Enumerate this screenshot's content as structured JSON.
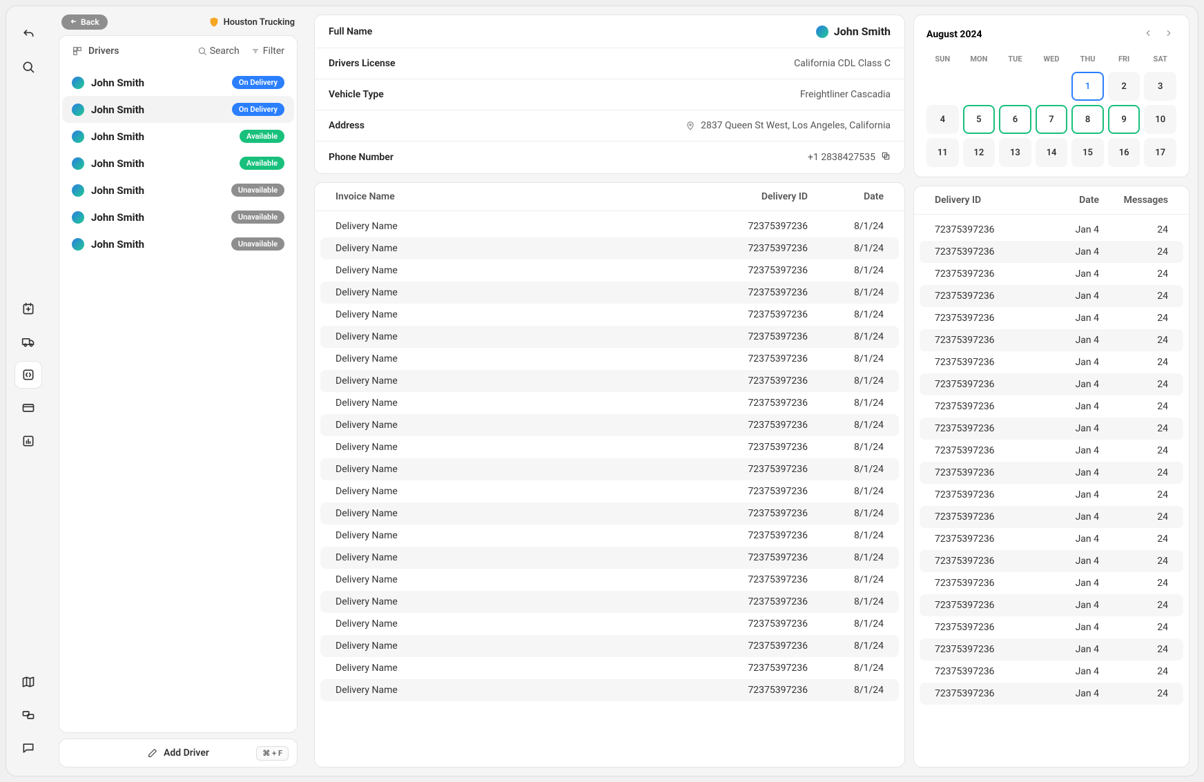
{
  "nav": {
    "back": "Back",
    "org": "Houston Trucking"
  },
  "drivers": {
    "title": "Drivers",
    "search": "Search",
    "filter": "Filter",
    "add": "Add Driver",
    "shortcut": "⌘ + F",
    "items": [
      {
        "name": "John Smith",
        "status": "On Delivery",
        "cls": "on-delivery",
        "selected": false
      },
      {
        "name": "John Smith",
        "status": "On Delivery",
        "cls": "on-delivery",
        "selected": true
      },
      {
        "name": "John Smith",
        "status": "Available",
        "cls": "available",
        "selected": false
      },
      {
        "name": "John Smith",
        "status": "Available",
        "cls": "available",
        "selected": false
      },
      {
        "name": "John Smith",
        "status": "Unavailable",
        "cls": "unavailable",
        "selected": false
      },
      {
        "name": "John Smith",
        "status": "Unavailable",
        "cls": "unavailable",
        "selected": false
      },
      {
        "name": "John Smith",
        "status": "Unavailable",
        "cls": "unavailable",
        "selected": false
      }
    ]
  },
  "details": {
    "full_name_l": "Full Name",
    "full_name_v": "John Smith",
    "license_l": "Drivers License",
    "license_v": "California CDL Class C",
    "vehicle_l": "Vehicle Type",
    "vehicle_v": "Freightliner Cascadia",
    "address_l": "Address",
    "address_v": "2837 Queen St West, Los Angeles, California",
    "phone_l": "Phone Number",
    "phone_v": "+1 2838427535"
  },
  "invoice_table": {
    "cols": {
      "name": "Invoice Name",
      "del": "Delivery ID",
      "date": "Date"
    },
    "rows": [
      {
        "name": "Delivery Name",
        "del": "72375397236",
        "date": "8/1/24"
      },
      {
        "name": "Delivery Name",
        "del": "72375397236",
        "date": "8/1/24"
      },
      {
        "name": "Delivery Name",
        "del": "72375397236",
        "date": "8/1/24"
      },
      {
        "name": "Delivery Name",
        "del": "72375397236",
        "date": "8/1/24"
      },
      {
        "name": "Delivery Name",
        "del": "72375397236",
        "date": "8/1/24"
      },
      {
        "name": "Delivery Name",
        "del": "72375397236",
        "date": "8/1/24"
      },
      {
        "name": "Delivery Name",
        "del": "72375397236",
        "date": "8/1/24"
      },
      {
        "name": "Delivery Name",
        "del": "72375397236",
        "date": "8/1/24"
      },
      {
        "name": "Delivery Name",
        "del": "72375397236",
        "date": "8/1/24"
      },
      {
        "name": "Delivery Name",
        "del": "72375397236",
        "date": "8/1/24"
      },
      {
        "name": "Delivery Name",
        "del": "72375397236",
        "date": "8/1/24"
      },
      {
        "name": "Delivery Name",
        "del": "72375397236",
        "date": "8/1/24"
      },
      {
        "name": "Delivery Name",
        "del": "72375397236",
        "date": "8/1/24"
      },
      {
        "name": "Delivery Name",
        "del": "72375397236",
        "date": "8/1/24"
      },
      {
        "name": "Delivery Name",
        "del": "72375397236",
        "date": "8/1/24"
      },
      {
        "name": "Delivery Name",
        "del": "72375397236",
        "date": "8/1/24"
      },
      {
        "name": "Delivery Name",
        "del": "72375397236",
        "date": "8/1/24"
      },
      {
        "name": "Delivery Name",
        "del": "72375397236",
        "date": "8/1/24"
      },
      {
        "name": "Delivery Name",
        "del": "72375397236",
        "date": "8/1/24"
      },
      {
        "name": "Delivery Name",
        "del": "72375397236",
        "date": "8/1/24"
      },
      {
        "name": "Delivery Name",
        "del": "72375397236",
        "date": "8/1/24"
      },
      {
        "name": "Delivery Name",
        "del": "72375397236",
        "date": "8/1/24"
      }
    ]
  },
  "calendar": {
    "month": "August 2024",
    "dow": [
      "SUN",
      "MON",
      "TUE",
      "WED",
      "THU",
      "FRI",
      "SAT"
    ],
    "days": [
      {
        "d": "",
        "cls": ""
      },
      {
        "d": "",
        "cls": ""
      },
      {
        "d": "",
        "cls": ""
      },
      {
        "d": "",
        "cls": ""
      },
      {
        "d": "1",
        "cls": "selected"
      },
      {
        "d": "2",
        "cls": ""
      },
      {
        "d": "3",
        "cls": ""
      },
      {
        "d": "4",
        "cls": ""
      },
      {
        "d": "5",
        "cls": "ranged"
      },
      {
        "d": "6",
        "cls": "ranged"
      },
      {
        "d": "7",
        "cls": "ranged"
      },
      {
        "d": "8",
        "cls": "ranged"
      },
      {
        "d": "9",
        "cls": "ranged"
      },
      {
        "d": "10",
        "cls": ""
      },
      {
        "d": "11",
        "cls": ""
      },
      {
        "d": "12",
        "cls": ""
      },
      {
        "d": "13",
        "cls": ""
      },
      {
        "d": "14",
        "cls": ""
      },
      {
        "d": "15",
        "cls": ""
      },
      {
        "d": "16",
        "cls": ""
      },
      {
        "d": "17",
        "cls": ""
      }
    ]
  },
  "msg_table": {
    "cols": {
      "del": "Delivery ID",
      "date": "Date",
      "msg": "Messages"
    },
    "rows": [
      {
        "del": "72375397236",
        "date": "Jan 4",
        "msg": "24"
      },
      {
        "del": "72375397236",
        "date": "Jan 4",
        "msg": "24"
      },
      {
        "del": "72375397236",
        "date": "Jan 4",
        "msg": "24"
      },
      {
        "del": "72375397236",
        "date": "Jan 4",
        "msg": "24"
      },
      {
        "del": "72375397236",
        "date": "Jan 4",
        "msg": "24"
      },
      {
        "del": "72375397236",
        "date": "Jan 4",
        "msg": "24"
      },
      {
        "del": "72375397236",
        "date": "Jan 4",
        "msg": "24"
      },
      {
        "del": "72375397236",
        "date": "Jan 4",
        "msg": "24"
      },
      {
        "del": "72375397236",
        "date": "Jan 4",
        "msg": "24"
      },
      {
        "del": "72375397236",
        "date": "Jan 4",
        "msg": "24"
      },
      {
        "del": "72375397236",
        "date": "Jan 4",
        "msg": "24"
      },
      {
        "del": "72375397236",
        "date": "Jan 4",
        "msg": "24"
      },
      {
        "del": "72375397236",
        "date": "Jan 4",
        "msg": "24"
      },
      {
        "del": "72375397236",
        "date": "Jan 4",
        "msg": "24"
      },
      {
        "del": "72375397236",
        "date": "Jan 4",
        "msg": "24"
      },
      {
        "del": "72375397236",
        "date": "Jan 4",
        "msg": "24"
      },
      {
        "del": "72375397236",
        "date": "Jan 4",
        "msg": "24"
      },
      {
        "del": "72375397236",
        "date": "Jan 4",
        "msg": "24"
      },
      {
        "del": "72375397236",
        "date": "Jan 4",
        "msg": "24"
      },
      {
        "del": "72375397236",
        "date": "Jan 4",
        "msg": "24"
      },
      {
        "del": "72375397236",
        "date": "Jan 4",
        "msg": "24"
      },
      {
        "del": "72375397236",
        "date": "Jan 4",
        "msg": "24"
      }
    ]
  }
}
